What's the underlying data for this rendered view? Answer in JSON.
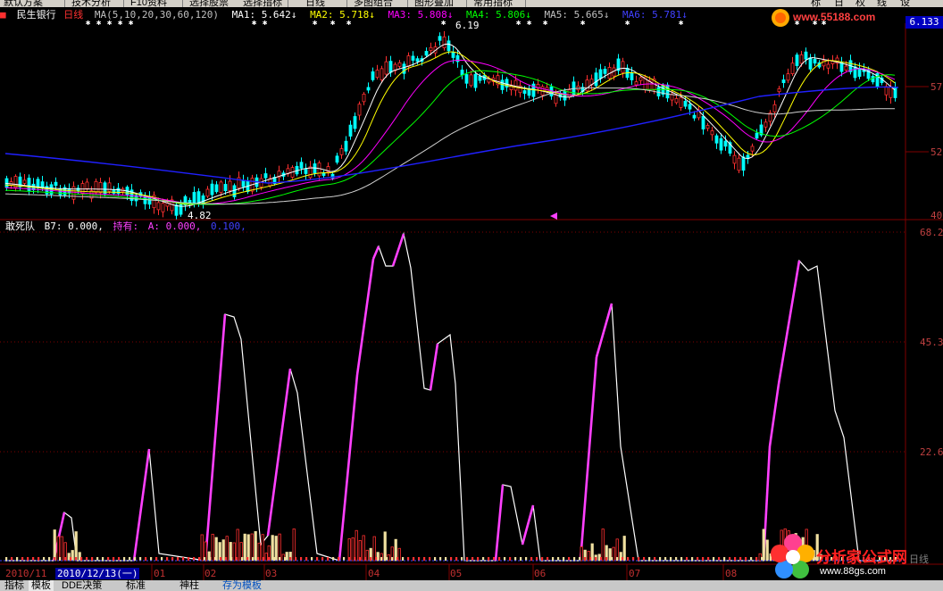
{
  "toolbar": {
    "items": [
      "默认方案",
      "技术分析",
      "F10资料",
      "选择股票",
      "选择指标",
      "日线",
      "多图组合",
      "图形叠加",
      "常用指标"
    ],
    "right_buttons": [
      "标",
      "日",
      "权",
      "线",
      "设"
    ]
  },
  "main_header": {
    "stock_name": "民生银行",
    "period": "日线",
    "ma_params": "MA(5,10,20,30,60,120)",
    "ma1": "MA1: 5.642↓",
    "ma2": "MA2: 5.718↓",
    "ma3": "MA3: 5.808↓",
    "ma4": "MA4: 5.806↓",
    "ma5": "MA5: 5.665↓",
    "ma6": "MA6: 5.781↓"
  },
  "price_tag": "6.133",
  "annotations": {
    "high": "6.19",
    "low": "4.82"
  },
  "price_axis": [
    "57",
    "52",
    "40"
  ],
  "indicator_header": {
    "name": "敢死队",
    "b7": "B7: 0.000,",
    "hold": "持有:",
    "a": "A: 0.000,",
    "b": "0.100,"
  },
  "indicator_axis": [
    "68.2",
    "45.3",
    "22.6"
  ],
  "dates": [
    "2010/11",
    "01",
    "02",
    "03",
    "04",
    "05",
    "06",
    "07",
    "08"
  ],
  "selected_date": "2010/12/13(一)",
  "tabs": [
    "指标",
    "模板",
    "DDE决策",
    "标准",
    "神柱",
    "存为模板"
  ],
  "watermarks": {
    "top_site": "www.55188.com",
    "bottom_title": "分析家公式网",
    "bottom_site": "www.88gs.com",
    "corner": "日线"
  },
  "colors": {
    "background": "#000000",
    "up": "#ff3030",
    "down": "#00ffff",
    "ma1": "#ffffff",
    "ma2": "#ffff00",
    "ma3": "#ff00ff",
    "ma4": "#00ff00",
    "ma5": "#0000ff",
    "indicator_line": "#ffffff",
    "indicator_up": "#ff40ff",
    "grid": "#800000"
  }
}
